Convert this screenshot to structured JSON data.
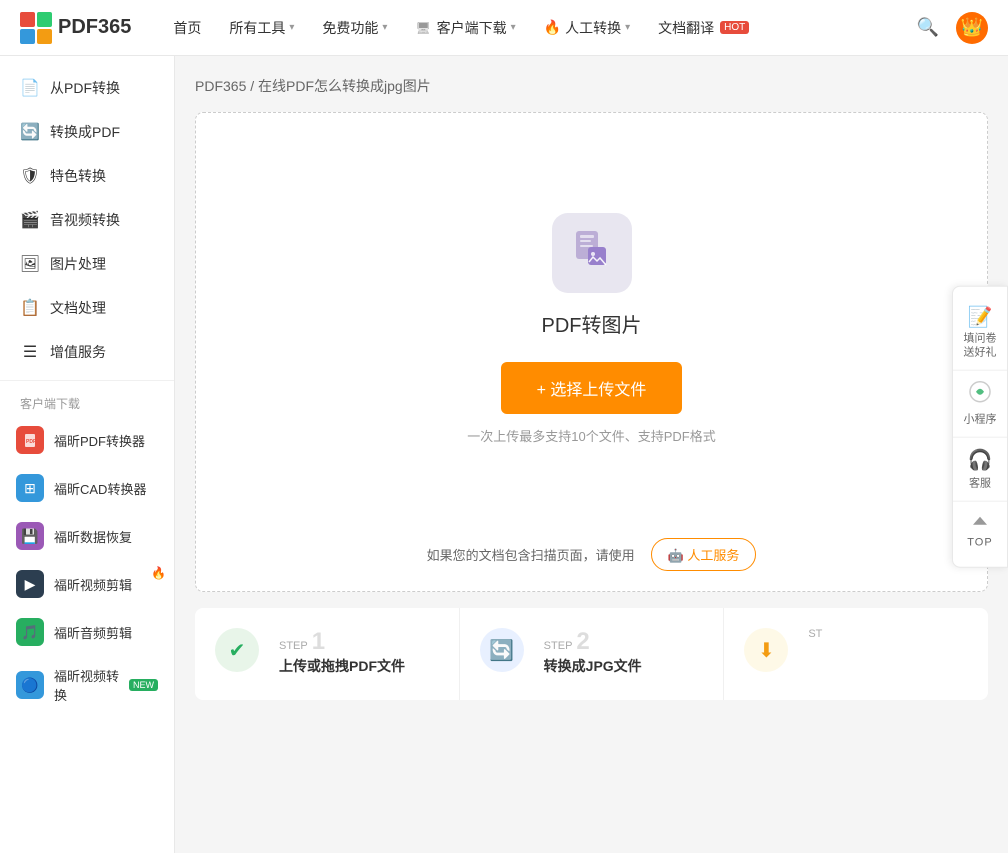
{
  "header": {
    "logo_text": "PDF365",
    "nav_items": [
      {
        "label": "首页",
        "has_chevron": false
      },
      {
        "label": "所有工具",
        "has_chevron": true
      },
      {
        "label": "免费功能",
        "has_chevron": true
      },
      {
        "label": "客户端下载",
        "has_chevron": true
      },
      {
        "label": "人工转换",
        "has_chevron": true
      },
      {
        "label": "文档翻译",
        "has_chevron": false,
        "badge": "HOT"
      }
    ]
  },
  "sidebar": {
    "menu_items": [
      {
        "id": "from-pdf",
        "icon": "📄",
        "label": "从PDF转换"
      },
      {
        "id": "to-pdf",
        "icon": "🔄",
        "label": "转换成PDF"
      },
      {
        "id": "special",
        "icon": "🛡",
        "label": "特色转换"
      },
      {
        "id": "audio-video",
        "icon": "🎬",
        "label": "音视频转换"
      },
      {
        "id": "image",
        "icon": "🖼",
        "label": "图片处理"
      },
      {
        "id": "doc",
        "icon": "📋",
        "label": "文档处理"
      },
      {
        "id": "vip",
        "icon": "☰",
        "label": "增值服务"
      }
    ],
    "section_title": "客户端下载",
    "apps": [
      {
        "id": "pdf-converter",
        "color": "red",
        "icon": "📄",
        "label": "福昕PDF转换器"
      },
      {
        "id": "cad-converter",
        "color": "blue",
        "icon": "📐",
        "label": "福昕CAD转换器"
      },
      {
        "id": "data-recovery",
        "color": "purple",
        "icon": "💾",
        "label": "福昕数据恢复"
      },
      {
        "id": "video-editor",
        "color": "dark",
        "icon": "🎬",
        "label": "福昕视频剪辑",
        "badge": "fire"
      },
      {
        "id": "audio-editor",
        "color": "green",
        "icon": "🎵",
        "label": "福昕音频剪辑"
      },
      {
        "id": "video-convert",
        "color": "blue",
        "icon": "▶",
        "label": "福昕视频转换",
        "badge": "new"
      }
    ]
  },
  "main": {
    "breadcrumb": "PDF365 / 在线PDF怎么转换成jpg图片",
    "card": {
      "pdf_icon": "📊",
      "title": "PDF转图片",
      "upload_btn": "+ 选择上传文件",
      "hint": "一次上传最多支持10个文件、支持PDF格式",
      "ai_hint": "如果您的文档包含扫描页面，请使用",
      "ai_btn": "🤖 人工服务"
    },
    "steps": [
      {
        "step_label": "STEP",
        "step_num": "1",
        "icon": "✔",
        "title": "上传或拖拽PDF文件",
        "desc": ""
      },
      {
        "step_label": "STEP",
        "step_num": "2",
        "icon": "🔄",
        "title": "转换成JPG文件",
        "desc": ""
      },
      {
        "step_label": "ST",
        "step_num": "",
        "icon": "⬇",
        "title": "",
        "desc": ""
      }
    ]
  },
  "right_panel": {
    "items": [
      {
        "icon": "📝",
        "label": "填问卷\n送好礼"
      },
      {
        "icon": "⚙",
        "label": "小程序"
      },
      {
        "icon": "🎧",
        "label": "客服"
      },
      {
        "icon": "⬆",
        "label": "TOP"
      }
    ]
  },
  "feedback": {
    "label": "填问卷送好礼"
  }
}
